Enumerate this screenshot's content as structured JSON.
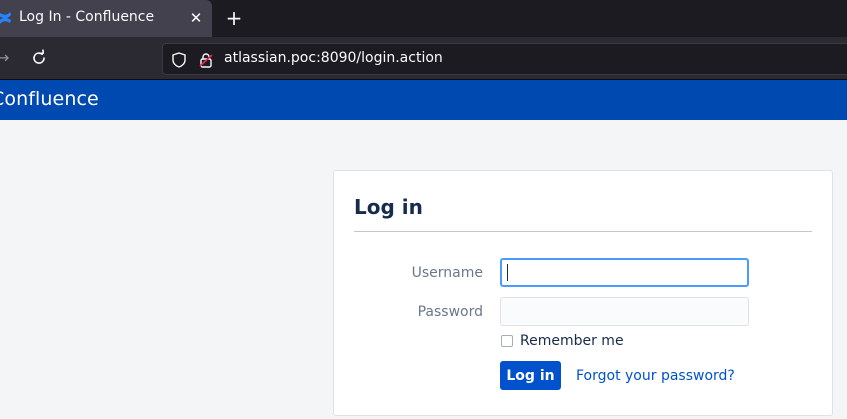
{
  "browser": {
    "tab": {
      "title": "Log In - Confluence",
      "close_icon": "close-icon",
      "favicon": "confluence-logo-icon"
    },
    "new_tab_label": "+",
    "url": "atlassian.poc:8090/login.action",
    "icons": [
      "forward-arrow-icon",
      "reload-icon",
      "shield-icon",
      "insecure-lock-icon"
    ]
  },
  "app": {
    "name": "Confluence",
    "brand_color": "#0049b0"
  },
  "login": {
    "title": "Log in",
    "username_label": "Username",
    "username_value": "",
    "password_label": "Password",
    "password_value": "",
    "remember_label": "Remember me",
    "remember_checked": false,
    "submit_label": "Log in",
    "forgot_label": "Forgot your password?",
    "button_color": "#0052cc",
    "focus_color": "#4c9aff"
  }
}
